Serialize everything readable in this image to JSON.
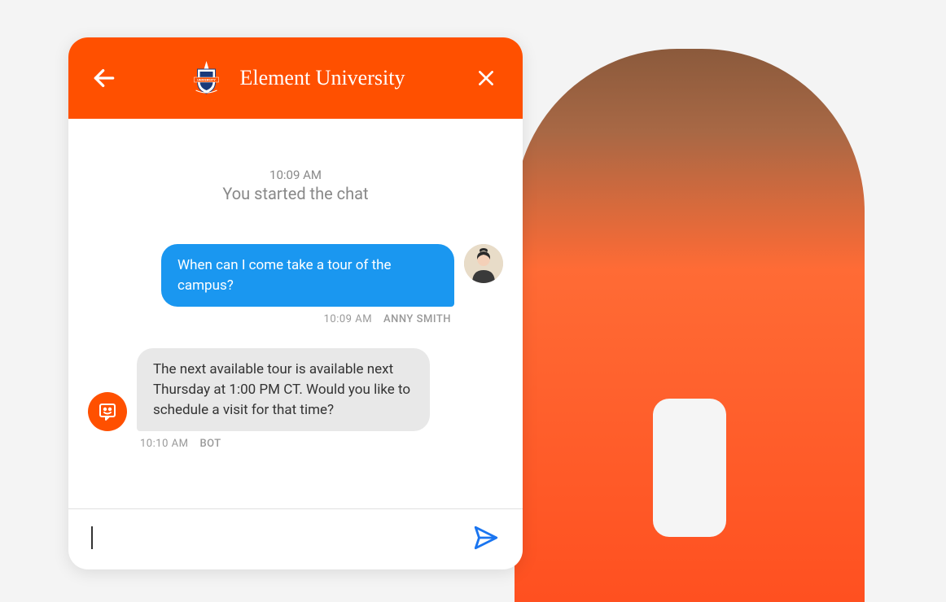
{
  "header": {
    "title": "Element University",
    "logo_label": "University Crest"
  },
  "chat": {
    "start_time": "10:09 AM",
    "start_text": "You started the chat",
    "messages": [
      {
        "role": "user",
        "text": "When can I come take a tour of the campus?",
        "time": "10:09 AM",
        "author": "ANNY SMITH"
      },
      {
        "role": "bot",
        "text": "The next available tour is available next Thursday at 1:00 PM CT. Would you like to schedule a visit for that time?",
        "time": "10:10 AM",
        "author": "BOT"
      }
    ]
  },
  "input": {
    "placeholder": "",
    "value": ""
  },
  "colors": {
    "brand": "#ff5000",
    "user_bubble": "#1a97f0",
    "bot_bubble": "#e8e8e8",
    "send_icon": "#1a75f0"
  }
}
